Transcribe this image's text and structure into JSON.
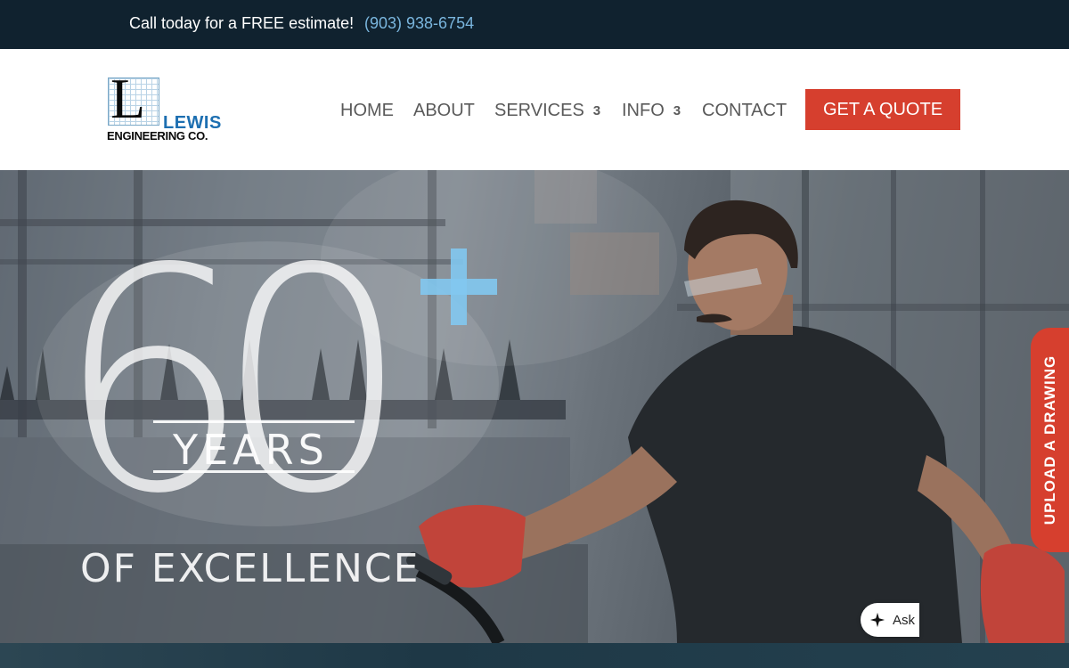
{
  "topbar": {
    "message": "Call today for a FREE estimate!",
    "phone": "(903) 938-6754"
  },
  "logo": {
    "letter": "L",
    "name": "LEWIS",
    "subtitle": "ENGINEERING CO."
  },
  "nav": {
    "items": [
      {
        "label": "HOME",
        "has_dropdown": false
      },
      {
        "label": "ABOUT",
        "has_dropdown": false
      },
      {
        "label": "SERVICES",
        "has_dropdown": true,
        "caret": "3"
      },
      {
        "label": "INFO",
        "has_dropdown": true,
        "caret": "3"
      },
      {
        "label": "CONTACT",
        "has_dropdown": false
      }
    ],
    "cta_label": "GET A QUOTE"
  },
  "hero": {
    "number": "60",
    "plus": "+",
    "years": "YEARS",
    "tagline": "OF EXCELLENCE"
  },
  "side_tab": {
    "label": "UPLOAD A DRAWING"
  },
  "ask_widget": {
    "label": "Ask",
    "icon": "sparkle-icon"
  },
  "colors": {
    "topbar_bg": "#10222f",
    "phone_link": "#7ab6de",
    "accent_red": "#d63f2e",
    "logo_blue": "#1d6fb1",
    "plus_blue": "#82c8f0"
  }
}
